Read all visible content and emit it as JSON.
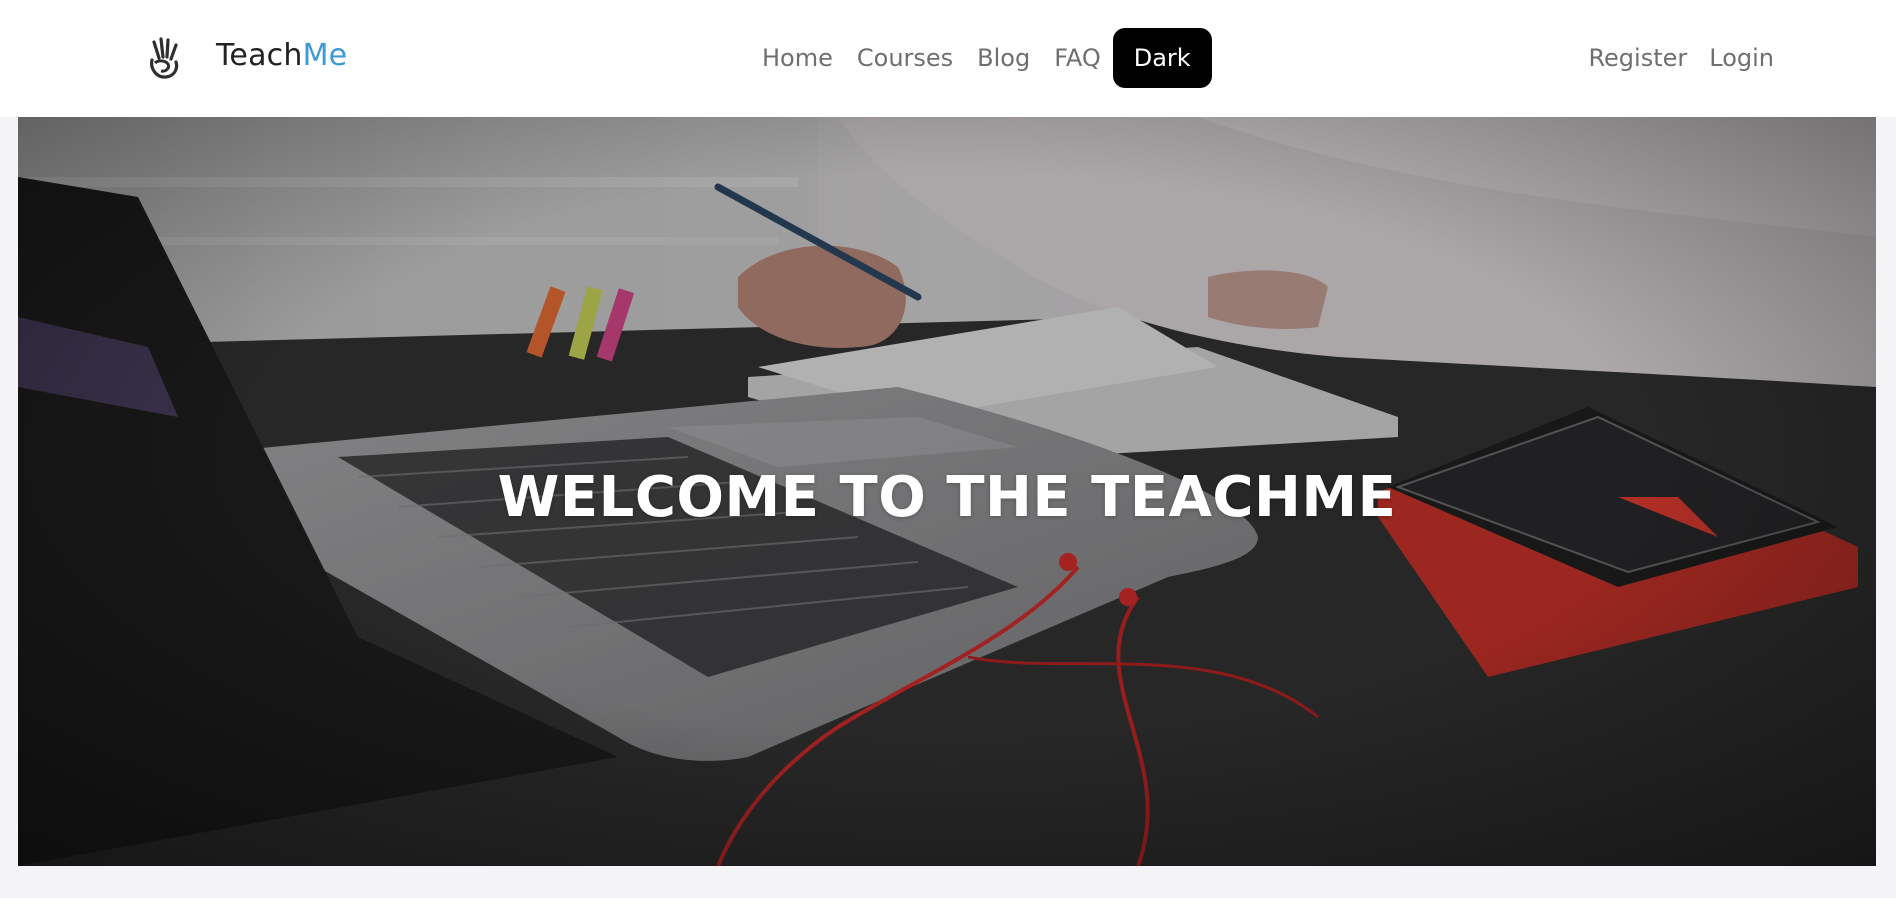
{
  "brand": {
    "name_part1": "Teach",
    "name_part2": "Me",
    "logo_icon": "hand-logo-icon",
    "accent_color": "#3c9ad8"
  },
  "nav": {
    "center_links": [
      "Home",
      "Courses",
      "Blog",
      "FAQ"
    ],
    "theme_toggle_label": "Dark",
    "right_links": [
      "Register",
      "Login"
    ]
  },
  "hero": {
    "title": "WELCOME TO THE TEACHME"
  }
}
